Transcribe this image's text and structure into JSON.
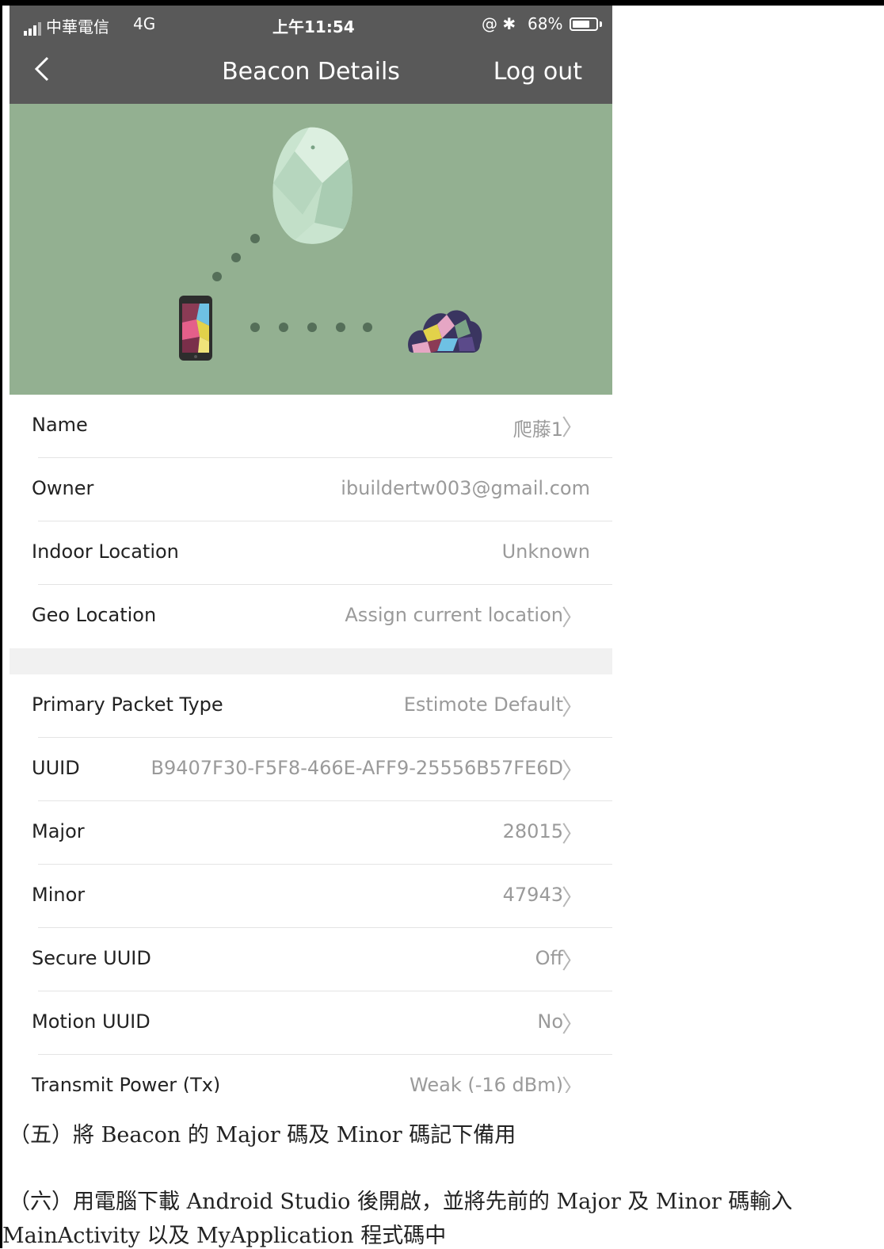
{
  "status_bar": {
    "carrier": "中華電信",
    "network": "4G",
    "time": "上午11:54",
    "icons": "@ ✱",
    "battery": "68%"
  },
  "nav": {
    "back_icon": "chevron-left",
    "title": "Beacon Details",
    "logout_label": "Log out"
  },
  "hero": {
    "background_color": "#93b091",
    "illustration": "beacon-phone-cloud"
  },
  "details": {
    "section1": [
      {
        "label": "Name",
        "value": "爬藤1",
        "chevron": true
      },
      {
        "label": "Owner",
        "value": "ibuildertw003@gmail.com",
        "chevron": false
      },
      {
        "label": "Indoor Location",
        "value": "Unknown",
        "chevron": false
      },
      {
        "label": "Geo Location",
        "value": "Assign current location",
        "chevron": true
      }
    ],
    "section2": [
      {
        "label": "Primary Packet Type",
        "value": "Estimote Default",
        "chevron": true
      },
      {
        "label": "UUID",
        "value": "B9407F30-F5F8-466E-AFF9-25556B57FE6D",
        "chevron": true
      },
      {
        "label": "Major",
        "value": "28015",
        "chevron": true
      },
      {
        "label": "Minor",
        "value": "47943",
        "chevron": true
      },
      {
        "label": "Secure UUID",
        "value": "Off",
        "chevron": true
      },
      {
        "label": "Motion UUID",
        "value": "No",
        "chevron": true
      },
      {
        "label": "Transmit Power (Tx)",
        "value": "Weak (-16 dBm)",
        "chevron": true
      }
    ],
    "chevron_glyph": "〉"
  },
  "document": {
    "step5": "（五）將 Beacon 的 Major 碼及 Minor 碼記下備用",
    "step6_line1": "（六）用電腦下載 Android Studio 後開啟，並將先前的 Major 及 Minor 碼輸入",
    "step6_line2": "MainActivity 以及 MyApplication 程式碼中"
  }
}
